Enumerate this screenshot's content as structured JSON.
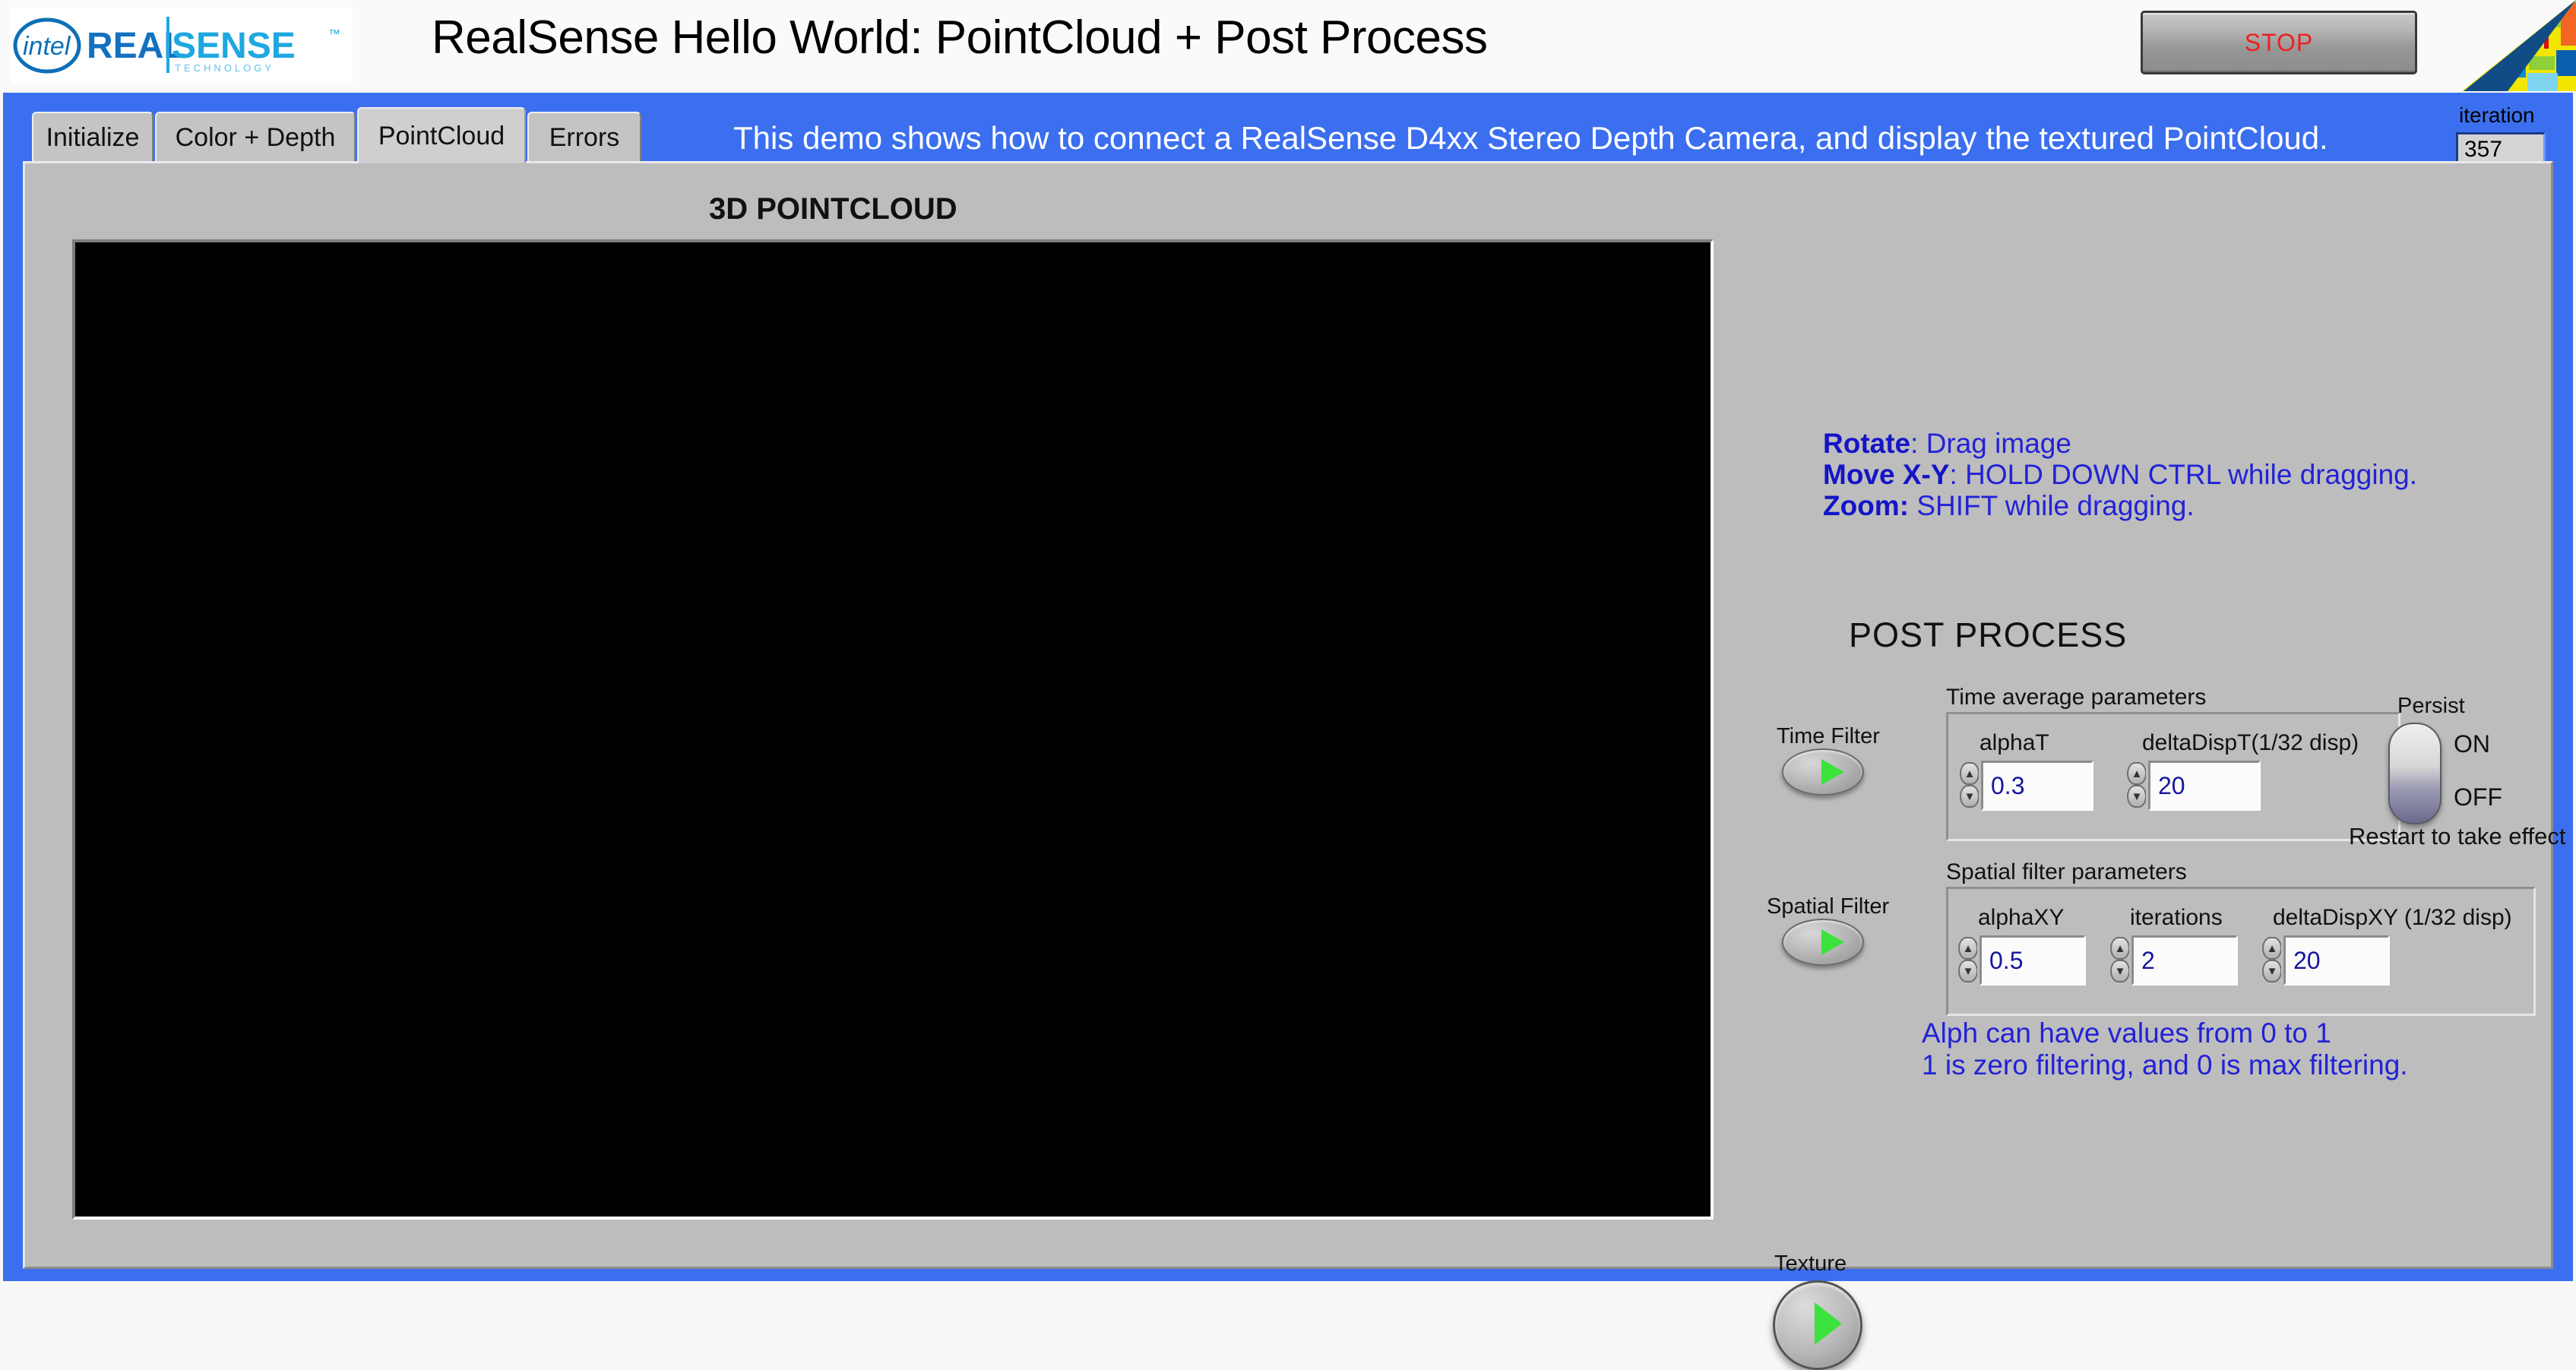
{
  "window": {
    "title": "RealSense Hello World: PointCloud + Post Process",
    "logo_alt": "intel RealSense Technology",
    "stop_label": "STOP"
  },
  "banner": {
    "text": "This demo shows how to connect a RealSense D4xx Stereo Depth Camera, and display the textured PointCloud.",
    "color": "#3b6ff0"
  },
  "iteration": {
    "label": "iteration",
    "value": "357"
  },
  "tabs": [
    {
      "label": "Initialize",
      "active": false
    },
    {
      "label": "Color + Depth",
      "active": false
    },
    {
      "label": "PointCloud",
      "active": true
    },
    {
      "label": "Errors",
      "active": false
    }
  ],
  "pointcloud": {
    "heading": "3D POINTCLOUD",
    "display_background": "#000000"
  },
  "hints": [
    {
      "key": "Rotate",
      "sep": ": ",
      "text": "Drag image"
    },
    {
      "key": "Move X-Y",
      "sep": ": ",
      "text": "HOLD DOWN CTRL while dragging."
    },
    {
      "key": "Zoom:",
      "sep": " ",
      "text": "SHIFT while dragging."
    }
  ],
  "post_process": {
    "heading": "POST PROCESS",
    "time_filter": {
      "toggle_label": "Time Filter",
      "state": "on",
      "group_title": "Time average parameters",
      "fields": [
        {
          "label": "alphaT",
          "value": "0.3"
        },
        {
          "label": "deltaDispT(1/32 disp)",
          "value": "20"
        }
      ]
    },
    "persist": {
      "label": "Persist",
      "option_on": "ON",
      "option_off": "OFF",
      "state": "ON",
      "note": "Restart to take effect"
    },
    "spatial_filter": {
      "toggle_label": "Spatial Filter",
      "state": "on",
      "group_title": "Spatial filter parameters",
      "fields": [
        {
          "label": "alphaXY",
          "value": "0.5"
        },
        {
          "label": "iterations",
          "value": "2"
        },
        {
          "label": "deltaDispXY (1/32 disp)",
          "value": "20"
        }
      ]
    },
    "alpha_notes": [
      "Alph can have values from 0 to 1",
      "1 is zero filtering, and 0 is max filtering."
    ],
    "texture": {
      "toggle_label": "Texture",
      "state": "on"
    }
  },
  "spinner": {
    "up": "▲",
    "down": "▼"
  }
}
